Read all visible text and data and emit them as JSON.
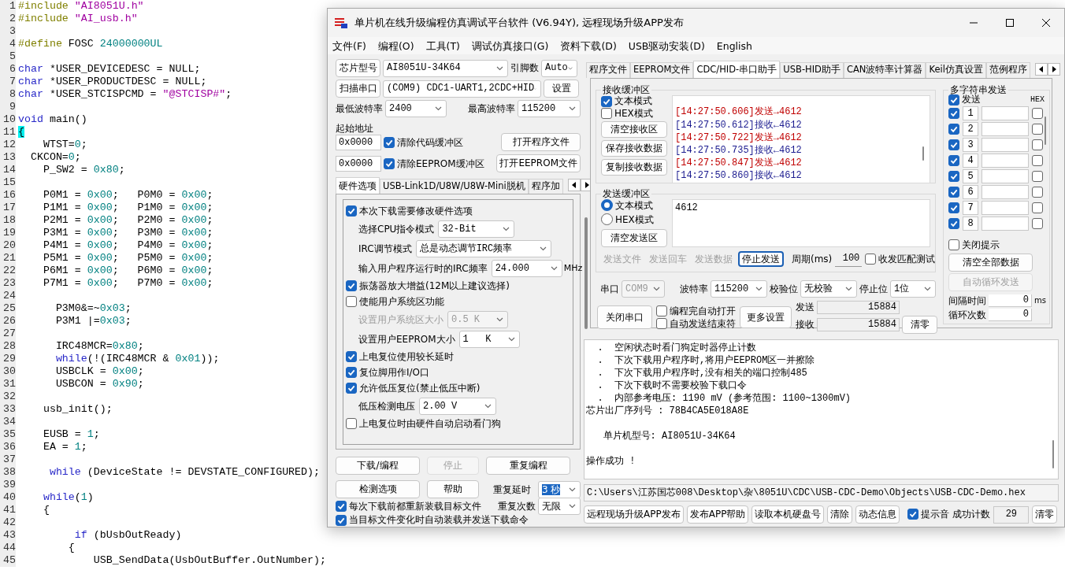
{
  "editor": {
    "lines": [
      {
        "number": "1",
        "tokens": [
          {
            "kind": "pp",
            "text": "#include "
          },
          {
            "kind": "str",
            "text": "\"AI8051U.h\""
          }
        ]
      },
      {
        "number": "2",
        "tokens": [
          {
            "kind": "pp",
            "text": "#include "
          },
          {
            "kind": "str",
            "text": "\"AI_usb.h\""
          }
        ]
      },
      {
        "number": "3"
      },
      {
        "number": "4",
        "tokens": [
          {
            "kind": "pp",
            "text": "#define"
          },
          {
            "kind": "plain",
            "text": " FOSC "
          },
          {
            "kind": "num",
            "text": "24000000UL"
          }
        ]
      },
      {
        "number": "5"
      },
      {
        "number": "6",
        "tokens": [
          {
            "kind": "kw",
            "text": "char"
          },
          {
            "kind": "plain",
            "text": " *USER_DEVICEDESC = NULL;"
          }
        ]
      },
      {
        "number": "7",
        "tokens": [
          {
            "kind": "kw",
            "text": "char"
          },
          {
            "kind": "plain",
            "text": " *USER_PRODUCTDESC = NULL;"
          }
        ]
      },
      {
        "number": "8",
        "tokens": [
          {
            "kind": "kw",
            "text": "char"
          },
          {
            "kind": "plain",
            "text": " *USER_STCISPCMD = "
          },
          {
            "kind": "str",
            "text": "\"@STCISP#\""
          },
          {
            "kind": "plain",
            "text": ";"
          }
        ]
      },
      {
        "number": "9"
      },
      {
        "number": "10",
        "tokens": [
          {
            "kind": "kw",
            "text": "void"
          },
          {
            "kind": "plain",
            "text": " main()"
          }
        ]
      },
      {
        "number": "11",
        "tokens": [
          {
            "kind": "match",
            "text": "{"
          }
        ]
      },
      {
        "number": "12",
        "tokens": [
          {
            "kind": "plain",
            "text": "    WTST="
          },
          {
            "kind": "num",
            "text": "0"
          },
          {
            "kind": "plain",
            "text": ";"
          }
        ]
      },
      {
        "number": "13",
        "tokens": [
          {
            "kind": "plain",
            "text": "  CKCON="
          },
          {
            "kind": "num",
            "text": "0"
          },
          {
            "kind": "plain",
            "text": ";"
          }
        ]
      },
      {
        "number": "14",
        "tokens": [
          {
            "kind": "plain",
            "text": "    P_SW2 = "
          },
          {
            "kind": "num",
            "text": "0x80"
          },
          {
            "kind": "plain",
            "text": ";"
          }
        ]
      },
      {
        "number": "15"
      },
      {
        "number": "16",
        "tokens": [
          {
            "kind": "plain",
            "text": "    P0M1 = "
          },
          {
            "kind": "num",
            "text": "0x00"
          },
          {
            "kind": "plain",
            "text": ";   P0M0 = "
          },
          {
            "kind": "num",
            "text": "0x00"
          },
          {
            "kind": "plain",
            "text": ";"
          }
        ]
      },
      {
        "number": "17",
        "tokens": [
          {
            "kind": "plain",
            "text": "    P1M1 = "
          },
          {
            "kind": "num",
            "text": "0x00"
          },
          {
            "kind": "plain",
            "text": ";   P1M0 = "
          },
          {
            "kind": "num",
            "text": "0x00"
          },
          {
            "kind": "plain",
            "text": ";"
          }
        ]
      },
      {
        "number": "18",
        "tokens": [
          {
            "kind": "plain",
            "text": "    P2M1 = "
          },
          {
            "kind": "num",
            "text": "0x00"
          },
          {
            "kind": "plain",
            "text": ";   P2M0 = "
          },
          {
            "kind": "num",
            "text": "0x00"
          },
          {
            "kind": "plain",
            "text": ";"
          }
        ]
      },
      {
        "number": "19",
        "tokens": [
          {
            "kind": "plain",
            "text": "    P3M1 = "
          },
          {
            "kind": "num",
            "text": "0x00"
          },
          {
            "kind": "plain",
            "text": ";   P3M0 = "
          },
          {
            "kind": "num",
            "text": "0x00"
          },
          {
            "kind": "plain",
            "text": ";"
          }
        ]
      },
      {
        "number": "20",
        "tokens": [
          {
            "kind": "plain",
            "text": "    P4M1 = "
          },
          {
            "kind": "num",
            "text": "0x00"
          },
          {
            "kind": "plain",
            "text": ";   P4M0 = "
          },
          {
            "kind": "num",
            "text": "0x00"
          },
          {
            "kind": "plain",
            "text": ";"
          }
        ]
      },
      {
        "number": "21",
        "tokens": [
          {
            "kind": "plain",
            "text": "    P5M1 = "
          },
          {
            "kind": "num",
            "text": "0x00"
          },
          {
            "kind": "plain",
            "text": ";   P5M0 = "
          },
          {
            "kind": "num",
            "text": "0x00"
          },
          {
            "kind": "plain",
            "text": ";"
          }
        ]
      },
      {
        "number": "22",
        "tokens": [
          {
            "kind": "plain",
            "text": "    P6M1 = "
          },
          {
            "kind": "num",
            "text": "0x00"
          },
          {
            "kind": "plain",
            "text": ";   P6M0 = "
          },
          {
            "kind": "num",
            "text": "0x00"
          },
          {
            "kind": "plain",
            "text": ";"
          }
        ]
      },
      {
        "number": "23",
        "tokens": [
          {
            "kind": "plain",
            "text": "    P7M1 = "
          },
          {
            "kind": "num",
            "text": "0x00"
          },
          {
            "kind": "plain",
            "text": ";   P7M0 = "
          },
          {
            "kind": "num",
            "text": "0x00"
          },
          {
            "kind": "plain",
            "text": ";"
          }
        ]
      },
      {
        "number": "24"
      },
      {
        "number": "25",
        "tokens": [
          {
            "kind": "plain",
            "text": "      P3M0&=~"
          },
          {
            "kind": "num",
            "text": "0x03"
          },
          {
            "kind": "plain",
            "text": ";"
          }
        ]
      },
      {
        "number": "26",
        "tokens": [
          {
            "kind": "plain",
            "text": "      P3M1 |="
          },
          {
            "kind": "num",
            "text": "0x03"
          },
          {
            "kind": "plain",
            "text": ";"
          }
        ]
      },
      {
        "number": "27"
      },
      {
        "number": "28",
        "tokens": [
          {
            "kind": "plain",
            "text": "      IRC48MCR="
          },
          {
            "kind": "num",
            "text": "0x80"
          },
          {
            "kind": "plain",
            "text": ";"
          }
        ]
      },
      {
        "number": "29",
        "tokens": [
          {
            "kind": "kw",
            "text": "      while"
          },
          {
            "kind": "plain",
            "text": "(!(IRC48MCR & "
          },
          {
            "kind": "num",
            "text": "0x01"
          },
          {
            "kind": "plain",
            "text": "));"
          }
        ]
      },
      {
        "number": "30",
        "tokens": [
          {
            "kind": "plain",
            "text": "      USBCLK = "
          },
          {
            "kind": "num",
            "text": "0x00"
          },
          {
            "kind": "plain",
            "text": ";"
          }
        ]
      },
      {
        "number": "31",
        "tokens": [
          {
            "kind": "plain",
            "text": "      USBCON = "
          },
          {
            "kind": "num",
            "text": "0x90"
          },
          {
            "kind": "plain",
            "text": ";"
          }
        ]
      },
      {
        "number": "32"
      },
      {
        "number": "33",
        "tokens": [
          {
            "kind": "plain",
            "text": "    usb_init();"
          }
        ]
      },
      {
        "number": "34"
      },
      {
        "number": "35",
        "tokens": [
          {
            "kind": "plain",
            "text": "    EUSB = "
          },
          {
            "kind": "num",
            "text": "1"
          },
          {
            "kind": "plain",
            "text": ";"
          }
        ]
      },
      {
        "number": "36",
        "tokens": [
          {
            "kind": "plain",
            "text": "    EA = "
          },
          {
            "kind": "num",
            "text": "1"
          },
          {
            "kind": "plain",
            "text": ";"
          }
        ]
      },
      {
        "number": "37"
      },
      {
        "number": "38",
        "tokens": [
          {
            "kind": "kw",
            "text": "     while"
          },
          {
            "kind": "plain",
            "text": " (DeviceState != DEVSTATE_CONFIGURED);"
          }
        ]
      },
      {
        "number": "39"
      },
      {
        "number": "40",
        "tokens": [
          {
            "kind": "kw",
            "text": "    while"
          },
          {
            "kind": "plain",
            "text": "("
          },
          {
            "kind": "num",
            "text": "1"
          },
          {
            "kind": "plain",
            "text": ")"
          }
        ]
      },
      {
        "number": "41",
        "tokens": [
          {
            "kind": "plain",
            "text": "    {"
          }
        ]
      },
      {
        "number": "42"
      },
      {
        "number": "43",
        "tokens": [
          {
            "kind": "kw",
            "text": "         if"
          },
          {
            "kind": "plain",
            "text": " (bUsbOutReady)"
          }
        ]
      },
      {
        "number": "44",
        "tokens": [
          {
            "kind": "plain",
            "text": "        {"
          }
        ]
      },
      {
        "number": "45",
        "tokens": [
          {
            "kind": "plain",
            "text": "            USB_SendData(UsbOutBuffer.OutNumber);"
          }
        ]
      }
    ]
  },
  "window": {
    "title": "单片机在线升级编程仿真调试平台软件 (V6.94Y), 远程现场升级APP发布"
  },
  "menu": [
    "文件(F)",
    "编程(O)",
    "工具(T)",
    "调试仿真接口(G)",
    "资料下载(D)",
    "USB驱动安装(D)",
    "English"
  ],
  "chip": {
    "button": "芯片型号",
    "value": "AI8051U-34K64",
    "pins_label": "引脚数",
    "pins_value": "Auto"
  },
  "port": {
    "button": "扫描串口",
    "value": "(COM9) CDC1-UART1,2CDC+HID",
    "settings_button": "设置"
  },
  "baud": {
    "min_label": "最低波特率",
    "min_value": "2400",
    "max_label": "最高波特率",
    "max_value": "115200"
  },
  "address": {
    "label": "起始地址",
    "rows": [
      {
        "value": "0x0000",
        "label": "清除代码缓冲区",
        "checked": true,
        "button": "打开程序文件"
      },
      {
        "value": "0x0000",
        "label": "清除EEPROM缓冲区",
        "checked": true,
        "button": "打开EEPROM文件"
      }
    ]
  },
  "left_tabs": [
    {
      "label": "硬件选项",
      "selected": true
    },
    {
      "label": "USB-Link1D/U8W/U8W-Mini脱机",
      "selected": false
    },
    {
      "label": "程序加",
      "selected": false
    }
  ],
  "hardware_options": [
    {
      "kind": "check",
      "label": "本次下载需要修改硬件选项",
      "checked": true,
      "disabled": false
    },
    {
      "kind": "select",
      "label": "选择CPU指令模式",
      "value": "32-Bit",
      "disabled": false
    },
    {
      "kind": "select",
      "label": "IRC调节模式",
      "value": "总是动态调节IRC频率",
      "disabled": false
    },
    {
      "kind": "select",
      "label": "输入用户程序运行时的IRC频率",
      "value": "24.000",
      "unit": "MHz",
      "disabled": false
    },
    {
      "kind": "check",
      "label": "振荡器放大增益(12M以上建议选择)",
      "checked": true,
      "disabled": false
    },
    {
      "kind": "check",
      "label": "使能用户系统区功能",
      "checked": false,
      "disabled": false
    },
    {
      "kind": "select",
      "label": "设置用户系统区大小",
      "value": "0.5 K",
      "disabled": true
    },
    {
      "kind": "select",
      "label": "设置用户EEPROM大小",
      "value": "1   K",
      "disabled": false
    },
    {
      "kind": "check",
      "label": "上电复位使用较长延时",
      "checked": true,
      "disabled": false
    },
    {
      "kind": "check",
      "label": "复位脚用作I/O口",
      "checked": true,
      "disabled": false
    },
    {
      "kind": "check",
      "label": "允许低压复位(禁止低压中断)",
      "checked": true,
      "disabled": false
    },
    {
      "kind": "select",
      "label": "低压检测电压",
      "value": "2.00 V",
      "disabled": false
    },
    {
      "kind": "check",
      "label": "上电复位时由硬件自动启动看门狗",
      "checked": false,
      "disabled": false
    }
  ],
  "actions": [
    {
      "label": "下载/编程",
      "disabled": false
    },
    {
      "label": "停止",
      "disabled": true
    },
    {
      "label": "重复编程",
      "disabled": false
    },
    {
      "label": "检测选项",
      "disabled": false
    },
    {
      "label": "帮助",
      "disabled": false
    }
  ],
  "repeat": {
    "delay_label": "重复延时",
    "delay_value": "3 秒",
    "delay_highlighted": true,
    "count_label": "重复次数",
    "count_value": "无限"
  },
  "reload_options": [
    {
      "label": "每次下载前都重新装载目标文件",
      "checked": true
    },
    {
      "label": "当目标文件变化时自动装载并发送下载命令",
      "checked": true
    }
  ],
  "right_tabs": [
    {
      "label": "程序文件",
      "selected": false
    },
    {
      "label": "EEPROM文件",
      "selected": false
    },
    {
      "label": "CDC/HID-串口助手",
      "selected": true
    },
    {
      "label": "USB-HID助手",
      "selected": false
    },
    {
      "label": "CAN波特率计算器",
      "selected": false
    },
    {
      "label": "Keil仿真设置",
      "selected": false
    },
    {
      "label": "范例程序",
      "selected": false
    }
  ],
  "receive": {
    "title": "接收缓冲区",
    "modes": [
      {
        "label": "文本模式",
        "checked": true
      },
      {
        "label": "HEX模式",
        "checked": false
      }
    ],
    "buttons": [
      "清空接收区",
      "保存接收数据",
      "复制接收数据"
    ],
    "log": [
      {
        "kind": "send",
        "text": "[14:27:50.606]发送→4612"
      },
      {
        "kind": "receive",
        "text": "[14:27:50.612]接收←4612"
      },
      {
        "kind": "send",
        "text": "[14:27:50.722]发送→4612"
      },
      {
        "kind": "receive",
        "text": "[14:27:50.735]接收←4612"
      },
      {
        "kind": "send",
        "text": "[14:27:50.847]发送→4612"
      },
      {
        "kind": "receive",
        "text": "[14:27:50.860]接收←4612"
      }
    ]
  },
  "send": {
    "title": "发送缓冲区",
    "modes": [
      {
        "label": "文本模式",
        "selected": true
      },
      {
        "label": "HEX模式",
        "selected": false
      }
    ],
    "clear_button": "清空发送区",
    "text": "4612",
    "buttons": [
      {
        "label": "发送文件",
        "disabled": true,
        "focused": false
      },
      {
        "label": "发送回车",
        "disabled": true,
        "focused": false
      },
      {
        "label": "发送数据",
        "disabled": true,
        "focused": false
      },
      {
        "label": "停止发送",
        "disabled": false,
        "focused": true
      }
    ],
    "period_label": "周期(ms)",
    "period_value": "100",
    "match_test": {
      "label": "收发匹配测试",
      "checked": false
    }
  },
  "serial": {
    "port_label": "串口",
    "port_value": "COM9",
    "port_disabled": true,
    "baud_label": "波特率",
    "baud_value": "115200",
    "parity_label": "校验位",
    "parity_value": "无校验",
    "stop_label": "停止位",
    "stop_value": "1位",
    "close_button": "关闭串口",
    "auto_options": [
      {
        "label": "编程完自动打开",
        "checked": false
      },
      {
        "label": "自动发送结束符",
        "checked": false
      }
    ],
    "more_button": "更多设置",
    "sent_label": "发送",
    "sent_value": "15884",
    "received_label": "接收",
    "received_value": "15884",
    "reset_button": "清零"
  },
  "multi_send": {
    "title": "多字符串发送",
    "send_label": "发送",
    "send_checked": true,
    "hex_label": "HEX",
    "rows": [
      {
        "number": "1",
        "checked": true,
        "hex": false
      },
      {
        "number": "2",
        "checked": true,
        "hex": false
      },
      {
        "number": "3",
        "checked": true,
        "hex": false
      },
      {
        "number": "4",
        "checked": true,
        "hex": false
      },
      {
        "number": "5",
        "checked": true,
        "hex": false
      },
      {
        "number": "6",
        "checked": true,
        "hex": false
      },
      {
        "number": "7",
        "checked": true,
        "hex": false
      },
      {
        "number": "8",
        "checked": true,
        "hex": false
      }
    ],
    "close_tip": {
      "label": "关闭提示",
      "checked": false
    },
    "clear_button": "清空全部数据",
    "loop_button": {
      "label": "自动循环发送",
      "disabled": true
    },
    "interval_label": "间隔时间",
    "interval_value": "0",
    "interval_unit": "ms",
    "loop_count_label": "循环次数",
    "loop_count_value": "0"
  },
  "output": {
    "lines": [
      {
        "text": "  .  空闲状态时看门狗定时器停止计数"
      },
      {
        "text": "  .  下次下载用户程序时,将用户EEPROM区一并擦除"
      },
      {
        "text": "  .  下次下载用户程序时,没有相关的端口控制485"
      },
      {
        "text": "  .  下次下载时不需要校验下载口令"
      },
      {
        "text": "  .  内部参考电压: 1190 mV (参考范围: 1100~1300mV)"
      },
      {
        "text": "芯片出厂序列号 : 78B4CA5E018A8E\n\n   单片机型号: AI8051U-34K64\n\n操作成功 !"
      }
    ]
  },
  "file_path": "C:\\Users\\江苏国芯008\\Desktop\\杂\\8051U\\CDC\\USB-CDC-Demo\\Objects\\USB-CDC-Demo.hex",
  "footer": {
    "buttons": [
      "远程现场升级APP发布",
      "发布APP帮助",
      "读取本机硬盘号",
      "清除",
      "动态信息"
    ],
    "sound": {
      "label": "提示音",
      "checked": true
    },
    "count_label": "成功计数",
    "count_value": "29",
    "reset_button": "清零"
  }
}
